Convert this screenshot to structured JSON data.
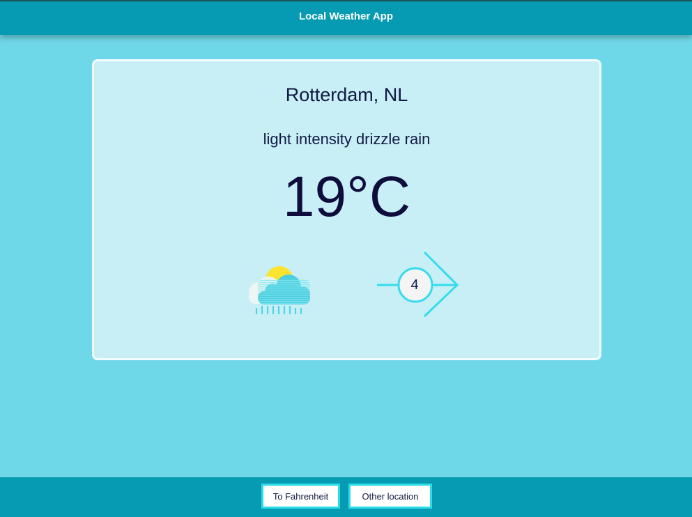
{
  "header": {
    "title": "Local Weather App"
  },
  "weather": {
    "location": "Rotterdam, NL",
    "description": "light intensity drizzle rain",
    "temperature": "19°C",
    "icon": "partly-cloudy-rain-icon",
    "wind_icon": "wind-direction-arrow-icon",
    "wind_speed": "4"
  },
  "footer": {
    "fahrenheit_button": "To Fahrenheit",
    "other_location_button": "Other location"
  },
  "colors": {
    "background": "#6fd8e8",
    "header": "#069bb2",
    "card": "#c8eff5",
    "accent": "#2edce9",
    "sun": "#fbe430",
    "text": "#111842"
  }
}
